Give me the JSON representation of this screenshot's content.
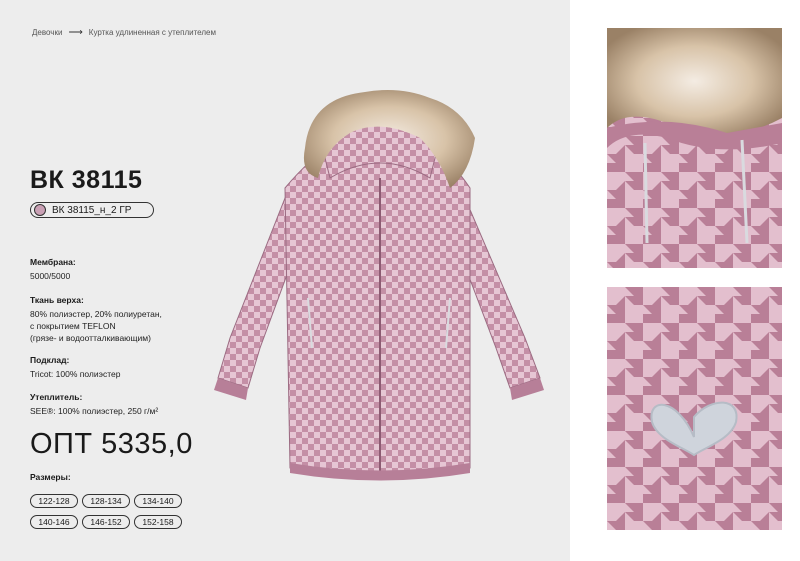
{
  "breadcrumb": {
    "parent": "Девочки",
    "current": "Куртка удлиненная с утеплителем"
  },
  "product": {
    "sku": "ВК 38115",
    "variant": "ВК 38115_н_2 ГР",
    "price": "ОПТ 5335,0"
  },
  "specs": [
    {
      "label": "Мембрана:",
      "value": "5000/5000"
    },
    {
      "label": "Ткань верха:",
      "value_lines": [
        "80% полиэстер, 20% полиуретан,",
        "с покрытием TEFLON",
        "(грязе- и водоотталкивающим)"
      ]
    },
    {
      "label": "Подклад:",
      "value": "Tricot: 100% полиэстер"
    },
    {
      "label": "Утеплитель:",
      "value": "SEE®: 100% полиэстер, 250 г/м²"
    }
  ],
  "sizes": {
    "label": "Размеры:",
    "items": [
      "122-128",
      "128-134",
      "134-140",
      "140-146",
      "146-152",
      "152-158"
    ]
  },
  "colors": {
    "fabric": "#c48fa6",
    "fabric_light": "#e6c6d4",
    "background": "#ededed",
    "fur": "#d8c3a8"
  }
}
